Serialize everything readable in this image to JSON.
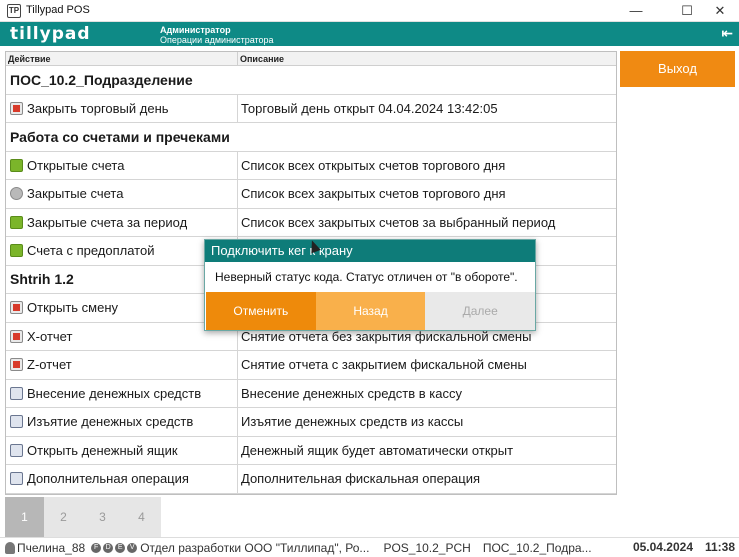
{
  "window": {
    "title": "Tillypad POS",
    "app_icon": "tillypad-app-icon"
  },
  "header": {
    "logo": "tillypad",
    "user_name": "Администратор",
    "user_role": "Операции администратора"
  },
  "table": {
    "col_action": "Действие",
    "col_description": "Описание",
    "rows": [
      {
        "type": "group",
        "label": "ПОС_10.2_Подразделение"
      },
      {
        "type": "item",
        "label": "Закрыть торговый день",
        "desc": "Торговый день открыт 04.04.2024 13:42:05",
        "icon": "close-day-icon"
      },
      {
        "type": "group",
        "label": "Работа со счетами и пречеками"
      },
      {
        "type": "item",
        "label": "Открытые счета",
        "desc": "Список всех открытых счетов торгового дня",
        "icon": "open-bills-icon"
      },
      {
        "type": "item",
        "label": "Закрытые счета",
        "desc": "Список всех закрытых счетов торгового дня",
        "icon": "closed-bills-icon"
      },
      {
        "type": "item",
        "label": "Закрытые счета за период",
        "desc": "Список всех закрытых счетов за выбранный период",
        "icon": "closed-bills-period-icon"
      },
      {
        "type": "item",
        "label": "Счета с предоплатой",
        "desc": "",
        "icon": "prepaid-bills-icon"
      },
      {
        "type": "group",
        "label": "Shtrih 1.2"
      },
      {
        "type": "item",
        "label": "Открыть смену",
        "desc": "",
        "icon": "open-shift-icon"
      },
      {
        "type": "item",
        "label": "X-отчет",
        "desc": "Снятие отчета без закрытия фискальной смены",
        "icon": "x-report-icon"
      },
      {
        "type": "item",
        "label": "Z-отчет",
        "desc": "Снятие отчета с закрытием фискальной смены",
        "icon": "z-report-icon"
      },
      {
        "type": "item",
        "label": "Внесение денежных средств",
        "desc": "Внесение денежных средств в кассу",
        "icon": "cash-in-icon"
      },
      {
        "type": "item",
        "label": "Изъятие денежных средств",
        "desc": "Изъятие денежных средств из кассы",
        "icon": "cash-out-icon"
      },
      {
        "type": "item",
        "label": "Открыть денежный ящик",
        "desc": "Денежный ящик будет автоматически открыт",
        "icon": "cash-drawer-icon"
      },
      {
        "type": "item",
        "label": "Дополнительная операция",
        "desc": "Дополнительная фискальная операция",
        "icon": "extra-operation-icon"
      }
    ]
  },
  "side": {
    "exit_label": "Выход"
  },
  "dialog": {
    "title": "Подключить кег к крану",
    "message": "Неверный статус кода. Статус отличен от \"в обороте\".",
    "cancel_label": "Отменить",
    "back_label": "Назад",
    "next_label": "Далее"
  },
  "pager": {
    "pages": [
      "1",
      "2",
      "3",
      "4"
    ],
    "active": "1"
  },
  "status": {
    "user": "Пчелина_88",
    "badges": [
      "F",
      "D",
      "E",
      "V"
    ],
    "company": "Отдел разработки ООО \"Тиллипад\", Ро...",
    "terminal": "POS_10.2_PCH",
    "subdivision": "ПОС_10.2_Подра...",
    "date": "05.04.2024",
    "time": "11:38"
  },
  "colors": {
    "header_teal": "#0e8a86",
    "accent_orange": "#f08a12"
  }
}
